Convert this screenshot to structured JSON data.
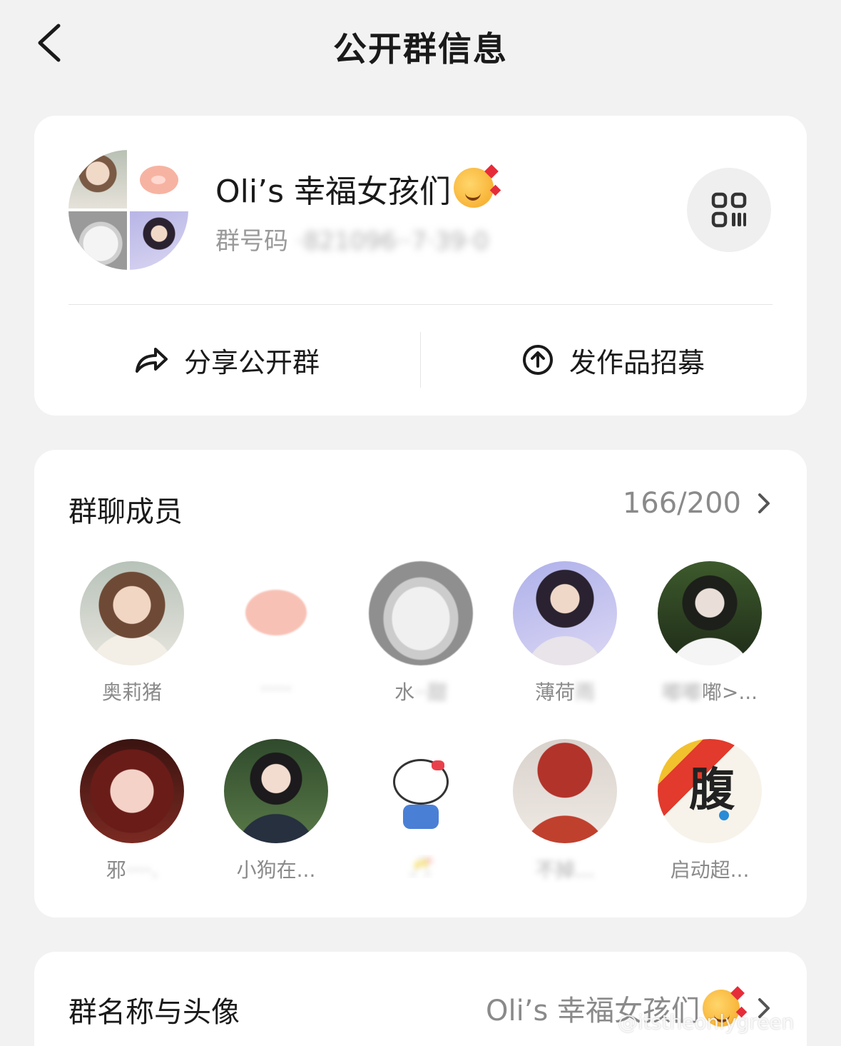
{
  "nav": {
    "title": "公开群信息"
  },
  "group": {
    "name": "Oli’s 幸福女孩们",
    "name_emoji": "smiling-face-with-hearts",
    "id_label": "群号码",
    "id_value_blurred": "·821096··7·39·0"
  },
  "actions": {
    "share_label": "分享公开群",
    "recruit_label": "发作品招募"
  },
  "members": {
    "title": "群聊成员",
    "count": "166/200",
    "list": [
      {
        "name": "奥莉猪",
        "visible": ""
      },
      {
        "name": "",
        "visible": "·····"
      },
      {
        "name": "水",
        "visible": "··甜"
      },
      {
        "name": "薄荷",
        "visible": "雨"
      },
      {
        "name": "嘟嘟",
        "visible": "嘟>..."
      },
      {
        "name": "邪",
        "visible": "····."
      },
      {
        "name": "小狗在...",
        "visible": ""
      },
      {
        "name": "",
        "visible": "🥂"
      },
      {
        "name": "",
        "visible": "不掉..."
      },
      {
        "name": "启动超...",
        "visible": ""
      }
    ]
  },
  "group_name_row": {
    "label": "群名称与头像",
    "value": "Oli’s 幸福女孩们"
  },
  "watermark": "@itstheonlygreen",
  "colors": {
    "background": "#f2f2f2",
    "card": "#ffffff",
    "secondary_text": "#8a8a8a",
    "primary_text": "#1a1a1a"
  }
}
